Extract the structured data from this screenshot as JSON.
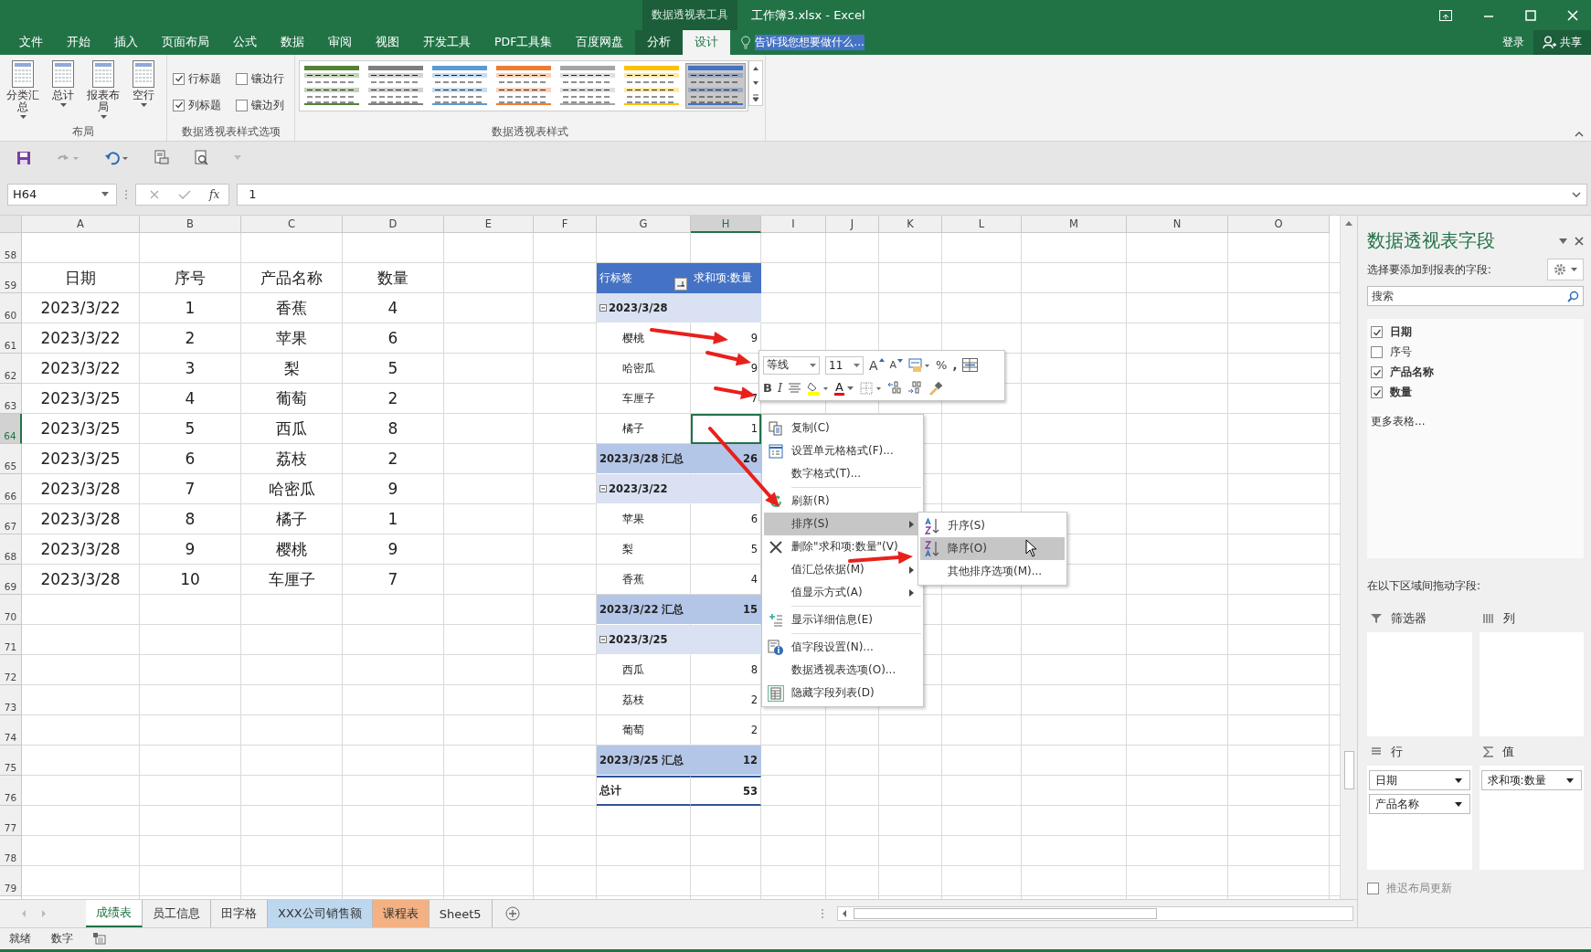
{
  "title_bar": {
    "context_tab": "数据透视表工具",
    "title": "工作簿3.xlsx - Excel"
  },
  "ribbon_tabs": [
    {
      "label": "文件",
      "selected": false,
      "contextual": false
    },
    {
      "label": "开始",
      "selected": false,
      "contextual": false
    },
    {
      "label": "插入",
      "selected": false,
      "contextual": false
    },
    {
      "label": "页面布局",
      "selected": false,
      "contextual": false
    },
    {
      "label": "公式",
      "selected": false,
      "contextual": false
    },
    {
      "label": "数据",
      "selected": false,
      "contextual": false
    },
    {
      "label": "审阅",
      "selected": false,
      "contextual": false
    },
    {
      "label": "视图",
      "selected": false,
      "contextual": false
    },
    {
      "label": "开发工具",
      "selected": false,
      "contextual": false
    },
    {
      "label": "PDF工具集",
      "selected": false,
      "contextual": false
    },
    {
      "label": "百度网盘",
      "selected": false,
      "contextual": false
    },
    {
      "label": "分析",
      "selected": false,
      "contextual": true
    },
    {
      "label": "设计",
      "selected": true,
      "contextual": true
    }
  ],
  "tell_me": {
    "placeholder": "告诉我您想要做什么..."
  },
  "sign_in": "登录",
  "share": "共享",
  "layout_group": {
    "name": "布局",
    "buttons": [
      {
        "label": "分类汇总"
      },
      {
        "label": "总计"
      },
      {
        "label": "报表布局"
      },
      {
        "label": "空行"
      }
    ]
  },
  "style_options_group": {
    "name": "数据透视表样式选项",
    "options": [
      {
        "label": "行标题",
        "checked": true
      },
      {
        "label": "镶边行",
        "checked": false
      },
      {
        "label": "列标题",
        "checked": true
      },
      {
        "label": "镶边列",
        "checked": false
      }
    ]
  },
  "styles_group": {
    "name": "数据透视表样式",
    "styles": [
      {
        "color": "#548235",
        "selected": false
      },
      {
        "color": "#7f7f7f",
        "selected": false
      },
      {
        "color": "#5b9bd5",
        "selected": false
      },
      {
        "color": "#ed7d31",
        "selected": false
      },
      {
        "color": "#a5a5a5",
        "selected": false
      },
      {
        "color": "#ffc000",
        "selected": false
      },
      {
        "color": "#4472c4",
        "selected": true
      }
    ]
  },
  "formula_bar": {
    "name_box": "H64",
    "fx": "fx",
    "value": "1"
  },
  "columns": [
    {
      "label": "A",
      "selected": false
    },
    {
      "label": "B",
      "selected": false
    },
    {
      "label": "C",
      "selected": false
    },
    {
      "label": "D",
      "selected": false
    },
    {
      "label": "E",
      "selected": false
    },
    {
      "label": "F",
      "selected": false
    },
    {
      "label": "G",
      "selected": false
    },
    {
      "label": "H",
      "selected": true
    },
    {
      "label": "I",
      "selected": false
    },
    {
      "label": "J",
      "selected": false
    },
    {
      "label": "K",
      "selected": false
    },
    {
      "label": "L",
      "selected": false
    },
    {
      "label": "M",
      "selected": false
    },
    {
      "label": "N",
      "selected": false
    },
    {
      "label": "O",
      "selected": false
    }
  ],
  "rows": [
    {
      "label": "58",
      "selected": false
    },
    {
      "label": "59",
      "selected": false
    },
    {
      "label": "60",
      "selected": false
    },
    {
      "label": "61",
      "selected": false
    },
    {
      "label": "62",
      "selected": false
    },
    {
      "label": "63",
      "selected": false
    },
    {
      "label": "64",
      "selected": true
    },
    {
      "label": "65",
      "selected": false
    },
    {
      "label": "66",
      "selected": false
    },
    {
      "label": "67",
      "selected": false
    },
    {
      "label": "68",
      "selected": false
    },
    {
      "label": "69",
      "selected": false
    },
    {
      "label": "70",
      "selected": false
    },
    {
      "label": "71",
      "selected": false
    },
    {
      "label": "72",
      "selected": false
    },
    {
      "label": "73",
      "selected": false
    },
    {
      "label": "74",
      "selected": false
    },
    {
      "label": "75",
      "selected": false
    },
    {
      "label": "76",
      "selected": false
    },
    {
      "label": "77",
      "selected": false
    },
    {
      "label": "78",
      "selected": false
    },
    {
      "label": "79",
      "selected": false
    }
  ],
  "data_table": {
    "header": [
      "日期",
      "序号",
      "产品名称",
      "数量"
    ],
    "rows": [
      [
        "2023/3/22",
        "1",
        "香蕉",
        "4"
      ],
      [
        "2023/3/22",
        "2",
        "苹果",
        "6"
      ],
      [
        "2023/3/22",
        "3",
        "梨",
        "5"
      ],
      [
        "2023/3/25",
        "4",
        "葡萄",
        "2"
      ],
      [
        "2023/3/25",
        "5",
        "西瓜",
        "8"
      ],
      [
        "2023/3/25",
        "6",
        "荔枝",
        "2"
      ],
      [
        "2023/3/28",
        "7",
        "哈密瓜",
        "9"
      ],
      [
        "2023/3/28",
        "8",
        "橘子",
        "1"
      ],
      [
        "2023/3/28",
        "9",
        "樱桃",
        "9"
      ],
      [
        "2023/3/28",
        "10",
        "车厘子",
        "7"
      ]
    ]
  },
  "pivot": {
    "header": [
      "行标签",
      "求和项:数量"
    ],
    "rows": [
      {
        "kind": "group",
        "label": "2023/3/28",
        "expanded": true
      },
      {
        "kind": "item",
        "label": "樱桃",
        "value": "9"
      },
      {
        "kind": "item",
        "label": "哈密瓜",
        "value": "9"
      },
      {
        "kind": "item",
        "label": "车厘子",
        "value": "7"
      },
      {
        "kind": "item",
        "label": "橘子",
        "value": "1"
      },
      {
        "kind": "subtotal",
        "label": "2023/3/28 汇总",
        "value": "26"
      },
      {
        "kind": "group",
        "label": "2023/3/22",
        "expanded": true
      },
      {
        "kind": "item",
        "label": "苹果",
        "value": "6"
      },
      {
        "kind": "item",
        "label": "梨",
        "value": "5"
      },
      {
        "kind": "item",
        "label": "香蕉",
        "value": "4"
      },
      {
        "kind": "subtotal",
        "label": "2023/3/22 汇总",
        "value": "15"
      },
      {
        "kind": "group",
        "label": "2023/3/25",
        "expanded": true
      },
      {
        "kind": "item",
        "label": "西瓜",
        "value": "8"
      },
      {
        "kind": "item",
        "label": "荔枝",
        "value": "2"
      },
      {
        "kind": "item",
        "label": "葡萄",
        "value": "2"
      },
      {
        "kind": "subtotal",
        "label": "2023/3/25 汇总",
        "value": "12"
      },
      {
        "kind": "total",
        "label": "总计",
        "value": "53"
      }
    ]
  },
  "mini_toolbar": {
    "font": "等线",
    "size": "11",
    "grow": "A",
    "shrink": "A",
    "percent": "%",
    "comma": ",",
    "bold": "B",
    "italic": "I",
    "font_color": "A"
  },
  "context_menu": {
    "items": [
      {
        "kind": "item",
        "label": "复制(C)",
        "selected": false
      },
      {
        "kind": "item",
        "label": "设置单元格格式(F)...",
        "selected": false
      },
      {
        "kind": "item",
        "label": "数字格式(T)...",
        "selected": false
      },
      {
        "kind": "separator"
      },
      {
        "kind": "item",
        "label": "刷新(R)",
        "selected": false
      },
      {
        "kind": "item",
        "label": "排序(S)",
        "submenu": true,
        "selected": true
      },
      {
        "kind": "item",
        "label": "删除\"求和项:数量\"(V)",
        "selected": false
      },
      {
        "kind": "item",
        "label": "值汇总依据(M)",
        "submenu": true,
        "selected": false
      },
      {
        "kind": "item",
        "label": "值显示方式(A)",
        "submenu": true,
        "selected": false
      },
      {
        "kind": "separator"
      },
      {
        "kind": "item",
        "label": "显示详细信息(E)",
        "selected": false
      },
      {
        "kind": "separator"
      },
      {
        "kind": "item",
        "label": "值字段设置(N)...",
        "selected": false
      },
      {
        "kind": "item",
        "label": "数据透视表选项(O)...",
        "selected": false
      },
      {
        "kind": "item",
        "label": "隐藏字段列表(D)",
        "selected": false
      }
    ]
  },
  "sort_submenu": {
    "items": [
      {
        "label": "升序(S)",
        "selected": false
      },
      {
        "label": "降序(O)",
        "selected": true
      },
      {
        "label": "其他排序选项(M)...",
        "selected": false
      }
    ]
  },
  "field_pane": {
    "title": "数据透视表字段",
    "prompt": "选择要添加到报表的字段:",
    "search": {
      "placeholder": "搜索"
    },
    "fields": [
      {
        "label": "日期",
        "checked": true
      },
      {
        "label": "序号",
        "checked": false
      },
      {
        "label": "产品名称",
        "checked": true
      },
      {
        "label": "数量",
        "checked": true
      }
    ],
    "more_tables": "更多表格...",
    "areas_prompt": "在以下区域间拖动字段:",
    "areas": [
      {
        "kind": "filters",
        "label": "筛选器"
      },
      {
        "kind": "columns",
        "label": "列"
      },
      {
        "kind": "rows",
        "label": "行",
        "items": [
          "日期",
          "产品名称"
        ]
      },
      {
        "kind": "values",
        "label": "值",
        "items": [
          "求和项:数量"
        ]
      }
    ],
    "defer_update": {
      "label": "推迟布局更新",
      "checked": false
    }
  },
  "sheet_tabs": [
    {
      "label": "成绩表",
      "selected": true
    },
    {
      "label": "员工信息",
      "selected": false
    },
    {
      "label": "田字格",
      "selected": false
    },
    {
      "label": "XXX公司销售额",
      "selected": false,
      "color": "#bdd7ee"
    },
    {
      "label": "课程表",
      "selected": false,
      "color": "#f4b183"
    },
    {
      "label": "Sheet5",
      "selected": false
    }
  ],
  "status_bar": {
    "items": [
      "就绪",
      "数字"
    ]
  }
}
